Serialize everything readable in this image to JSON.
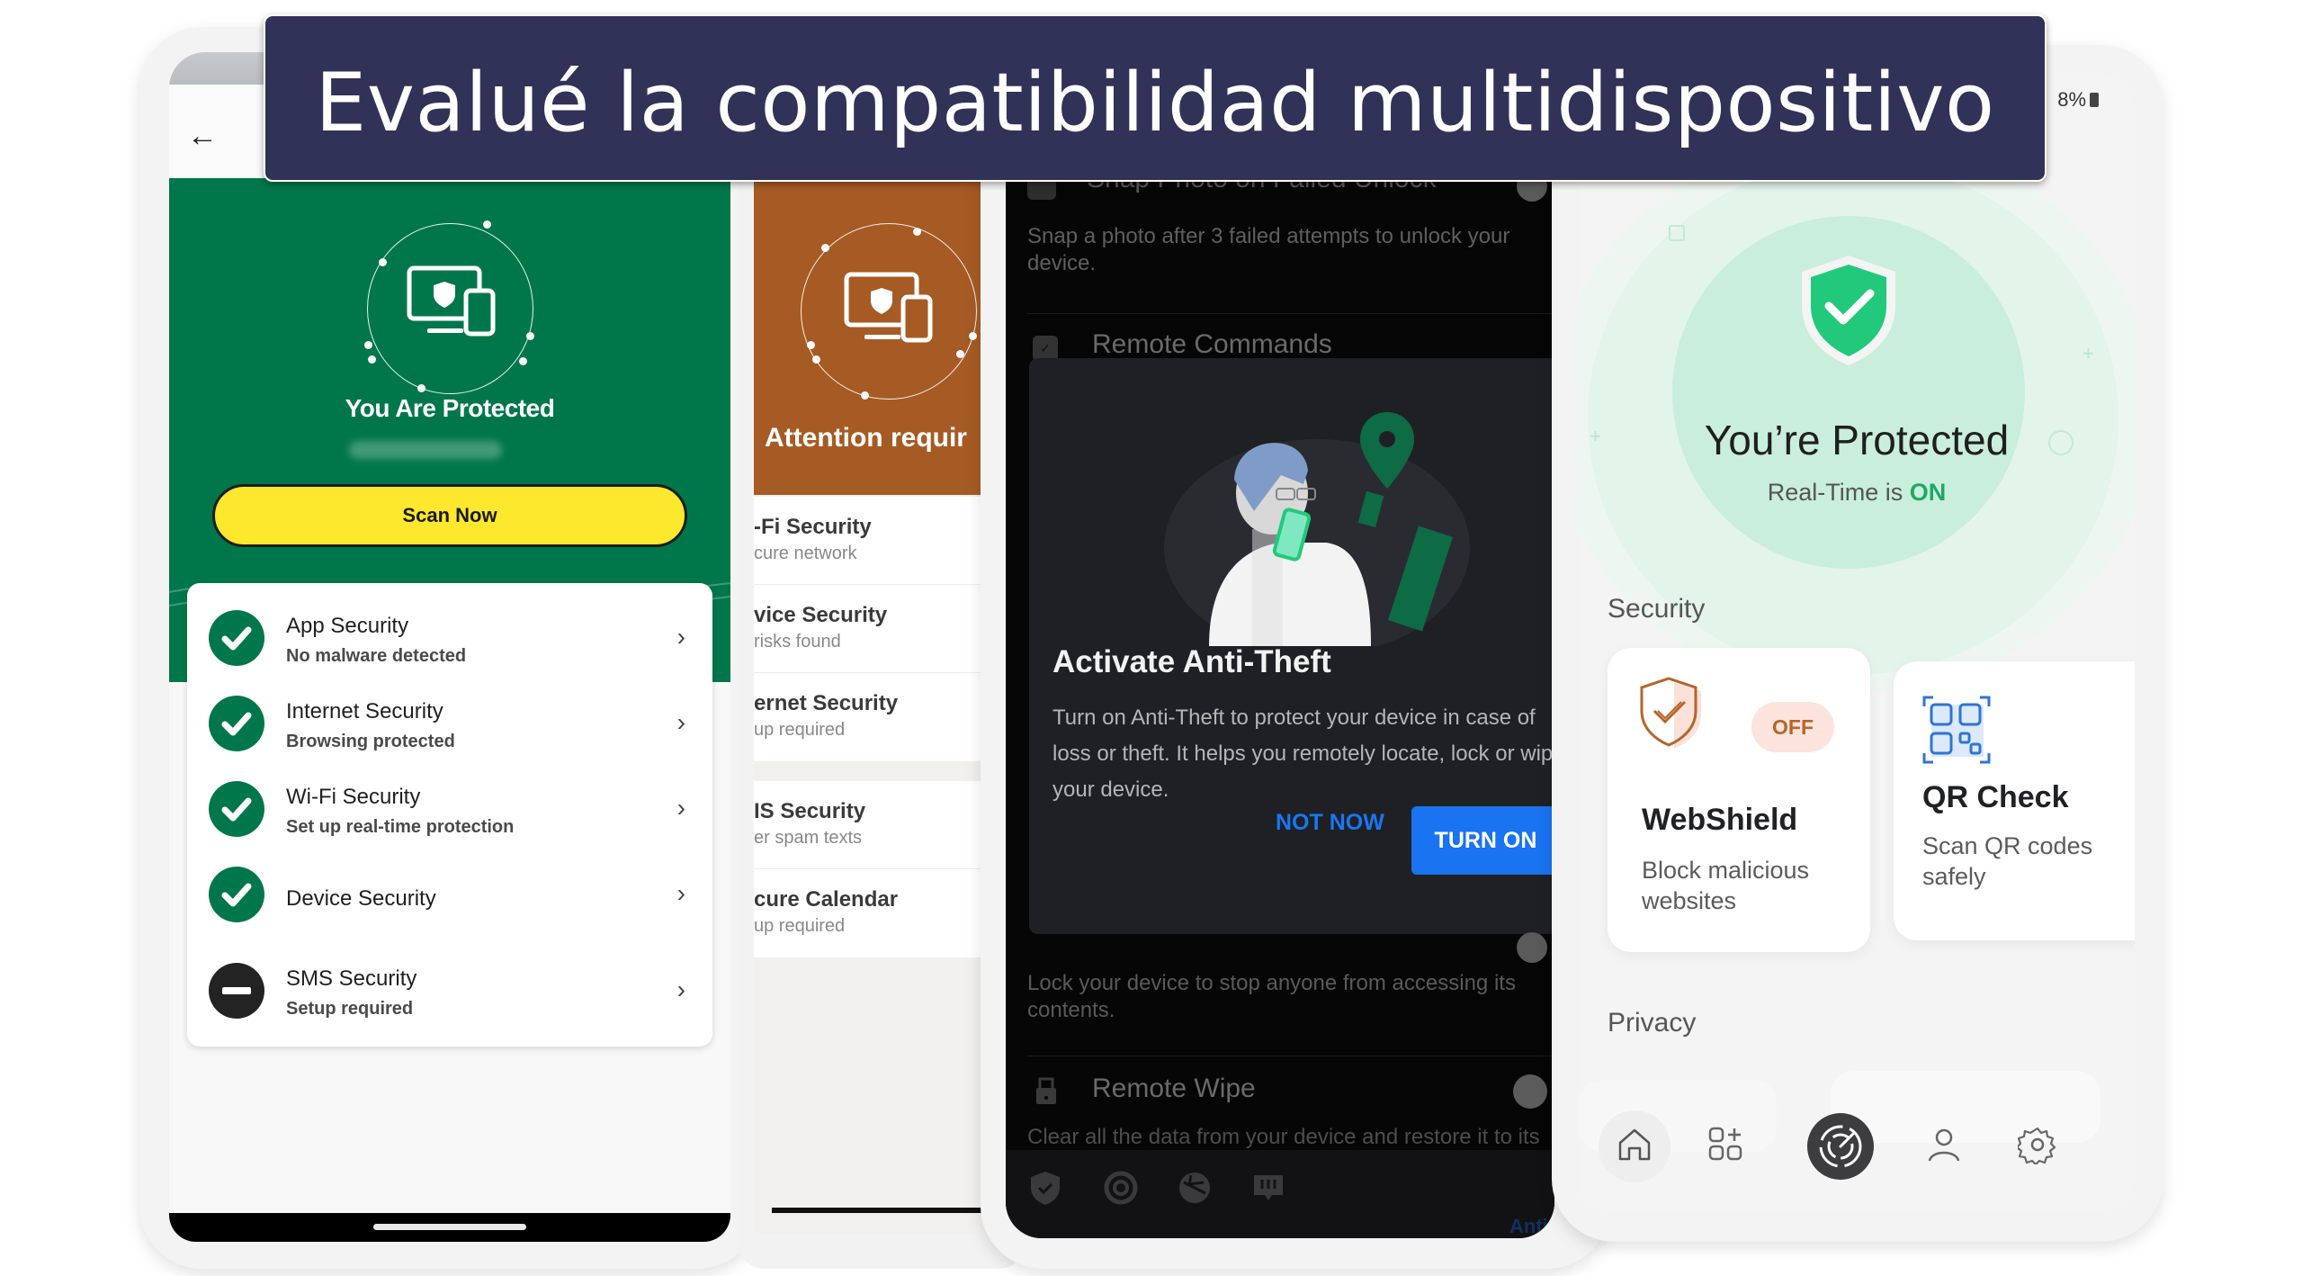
{
  "banner": {
    "title": "Evalué la compatibilidad multidispositivo"
  },
  "colors": {
    "banner_bg": "#313257",
    "green_brand": "#00774a",
    "orange_alert": "#a65b24",
    "scan_yellow": "#fde82e",
    "dialog_blue": "#1a73f0",
    "avast_green": "#22c97b",
    "off_orange": "#b5652a"
  },
  "phone1": {
    "back_icon": "arrow-left-icon",
    "status_title": "You Are Protected",
    "scan_button": "Scan Now",
    "items": [
      {
        "title": "App Security",
        "subtitle": "No malware detected",
        "status": "ok"
      },
      {
        "title": "Internet Security",
        "subtitle": "Browsing protected",
        "status": "ok"
      },
      {
        "title": "Wi-Fi Security",
        "subtitle": "Set up real-time protection",
        "status": "ok"
      },
      {
        "title": "Device Security",
        "subtitle": "",
        "status": "ok"
      },
      {
        "title": "SMS Security",
        "subtitle": "Setup required",
        "status": "warning"
      }
    ]
  },
  "phone2": {
    "status_title": "Attention requir",
    "group1": [
      {
        "title": "-Fi Security",
        "subtitle": "cure network"
      },
      {
        "title": "vice Security",
        "subtitle": "risks found"
      },
      {
        "title": "ernet Security",
        "subtitle": "up required"
      }
    ],
    "group2": [
      {
        "title": "IS Security",
        "subtitle": "er spam texts"
      },
      {
        "title": "cure Calendar",
        "subtitle": "up required"
      }
    ]
  },
  "phone3": {
    "snap_title": "Snap Photo on Failed Unlock",
    "snap_desc": "Snap a photo after 3 failed attempts to unlock your device.",
    "remote_commands": "Remote Commands",
    "dialog": {
      "title": "Activate Anti-Theft",
      "body": "Turn on Anti-Theft to protect your device in case of loss or theft. It helps you remotely locate, lock or wipe your device.",
      "not_now": "NOT NOW",
      "turn_on": "TURN ON"
    },
    "lock_desc": "Lock your device to stop anyone from accessing its contents.",
    "remote_wipe": "Remote Wipe",
    "wipe_desc": "Clear all the data from your device and restore it to its",
    "nav_active_label": "Anti-T"
  },
  "phone4": {
    "battery": "8%",
    "status_title": "You’re Protected",
    "realtime_prefix": "Real-Time is ",
    "realtime_state": "ON",
    "security_label": "Security",
    "cards": {
      "webshield": {
        "title": "WebShield",
        "desc": "Block malicious websites",
        "badge": "OFF"
      },
      "qrcheck": {
        "title": "QR Check",
        "desc": "Scan QR codes safely"
      }
    },
    "privacy_label": "Privacy"
  }
}
